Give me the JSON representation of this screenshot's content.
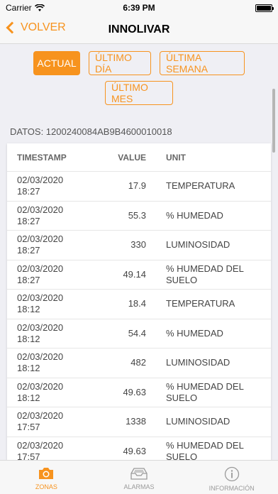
{
  "status": {
    "carrier": "Carrier",
    "time": "6:39 PM"
  },
  "nav": {
    "back_label": "VOLVER",
    "title": "INNOLIVAR"
  },
  "filters": [
    {
      "label": "ACTUAL",
      "active": true
    },
    {
      "label": "ÚLTIMO DÍA",
      "active": false
    },
    {
      "label": "ÚLTIMA SEMANA",
      "active": false
    },
    {
      "label": "ÚLTIMO MES",
      "active": false
    }
  ],
  "datos_label": "DATOS: 1200240084AB9B4600010018",
  "table": {
    "headers": {
      "timestamp": "TIMESTAMP",
      "value": "VALUE",
      "unit": "UNIT"
    },
    "rows": [
      {
        "timestamp": "02/03/2020\n18:27",
        "value": "17.9",
        "unit": "TEMPERATURA"
      },
      {
        "timestamp": "02/03/2020\n18:27",
        "value": "55.3",
        "unit": "% HUMEDAD"
      },
      {
        "timestamp": "02/03/2020\n18:27",
        "value": "330",
        "unit": "LUMINOSIDAD"
      },
      {
        "timestamp": "02/03/2020\n18:27",
        "value": "49.14",
        "unit": "% HUMEDAD DEL SUELO"
      },
      {
        "timestamp": "02/03/2020\n18:12",
        "value": "18.4",
        "unit": "TEMPERATURA"
      },
      {
        "timestamp": "02/03/2020\n18:12",
        "value": "54.4",
        "unit": "% HUMEDAD"
      },
      {
        "timestamp": "02/03/2020\n18:12",
        "value": "482",
        "unit": "LUMINOSIDAD"
      },
      {
        "timestamp": "02/03/2020\n18:12",
        "value": "49.63",
        "unit": "% HUMEDAD DEL SUELO"
      },
      {
        "timestamp": "02/03/2020\n17:57",
        "value": "1338",
        "unit": "LUMINOSIDAD"
      },
      {
        "timestamp": "02/03/2020\n17:57",
        "value": "49.63",
        "unit": "% HUMEDAD DEL SUELO"
      }
    ]
  },
  "tabs": [
    {
      "label": "ZONAS",
      "icon": "camera-icon",
      "active": true
    },
    {
      "label": "ALARMAS",
      "icon": "inbox-icon",
      "active": false
    },
    {
      "label": "INFORMACIÓN",
      "icon": "info-icon",
      "active": false
    }
  ],
  "colors": {
    "accent": "#f7931e",
    "inactive": "#9a9a9a"
  }
}
